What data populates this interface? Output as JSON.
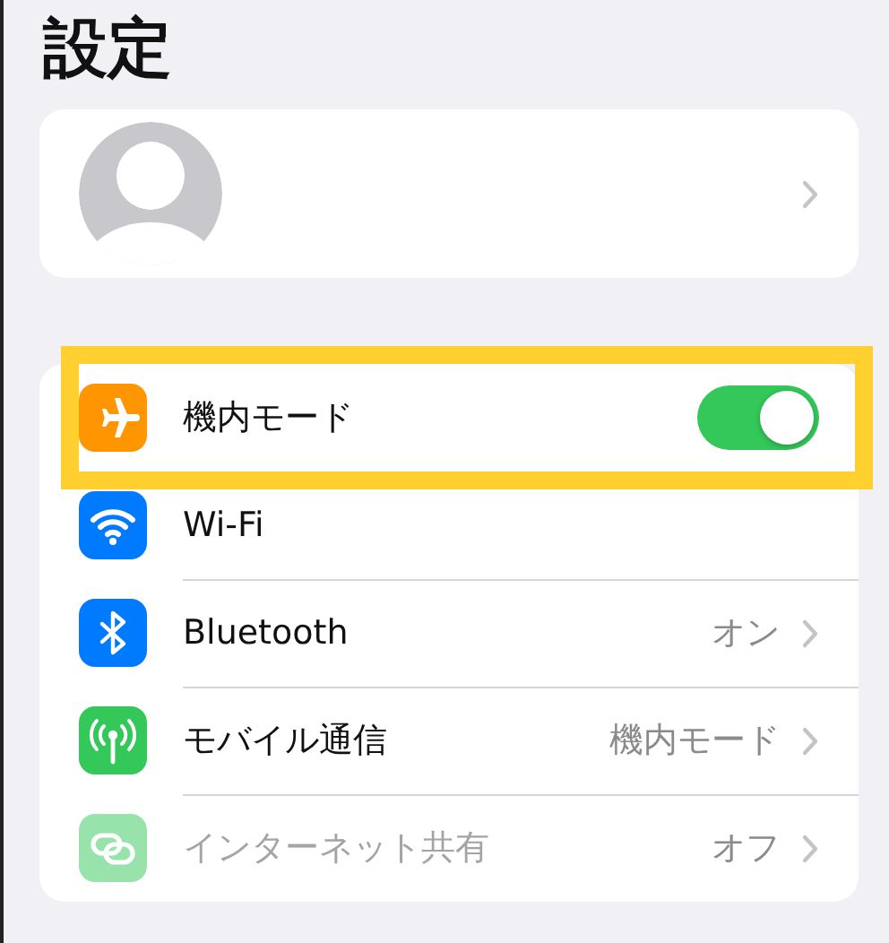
{
  "title": "設定",
  "rows": [
    {
      "kind": "toggle",
      "label": "機内モード",
      "on": true,
      "disabled": false,
      "highlighted": true
    },
    {
      "kind": "link",
      "label": "Wi-Fi",
      "chevron": false,
      "disabled": false,
      "highlighted": false
    },
    {
      "kind": "link",
      "label": "Bluetooth",
      "value": "オン",
      "chevron": true,
      "disabled": false,
      "highlighted": false
    },
    {
      "kind": "link",
      "label": "モバイル通信",
      "value": "機内モード",
      "chevron": true,
      "disabled": false,
      "highlighted": false
    },
    {
      "kind": "link",
      "label": "インターネット共有",
      "value": "オフ",
      "chevron": true,
      "disabled": true,
      "highlighted": false
    }
  ]
}
